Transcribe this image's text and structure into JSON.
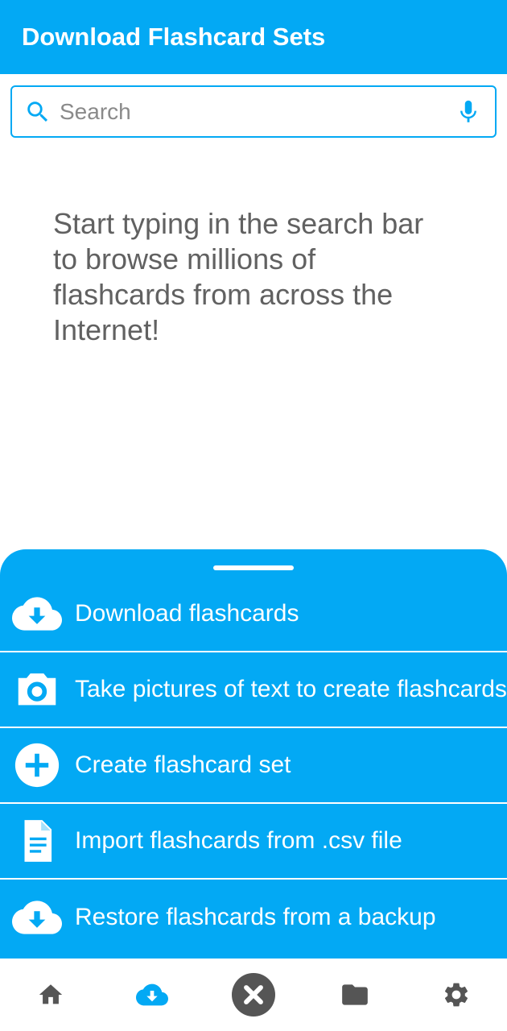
{
  "header": {
    "title": "Download Flashcard Sets"
  },
  "search": {
    "placeholder": "Search",
    "value": "",
    "icon": "search-icon",
    "voice_icon": "microphone-icon"
  },
  "hint": "Start typing in the search bar to browse millions of flashcards from across the Internet!",
  "sheet": {
    "items": [
      {
        "label": "Download flashcards",
        "icon": "cloud-download-icon"
      },
      {
        "label": "Take pictures of text to create flashcards",
        "icon": "camera-icon"
      },
      {
        "label": "Create flashcard set",
        "icon": "add-circle-icon"
      },
      {
        "label": "Import flashcards from .csv file",
        "icon": "document-icon"
      },
      {
        "label": "Restore flashcards from a backup",
        "icon": "cloud-download-icon"
      }
    ]
  },
  "nav": {
    "items": [
      {
        "icon": "home-icon",
        "active": false
      },
      {
        "icon": "cloud-download-icon",
        "active": true
      },
      {
        "icon": "close-icon",
        "active": false
      },
      {
        "icon": "folder-icon",
        "active": false
      },
      {
        "icon": "gear-icon",
        "active": false
      }
    ]
  },
  "colors": {
    "primary": "#03a9f4",
    "on_primary": "#ffffff",
    "hint_text": "#616161",
    "nav_icon": "#555555"
  }
}
